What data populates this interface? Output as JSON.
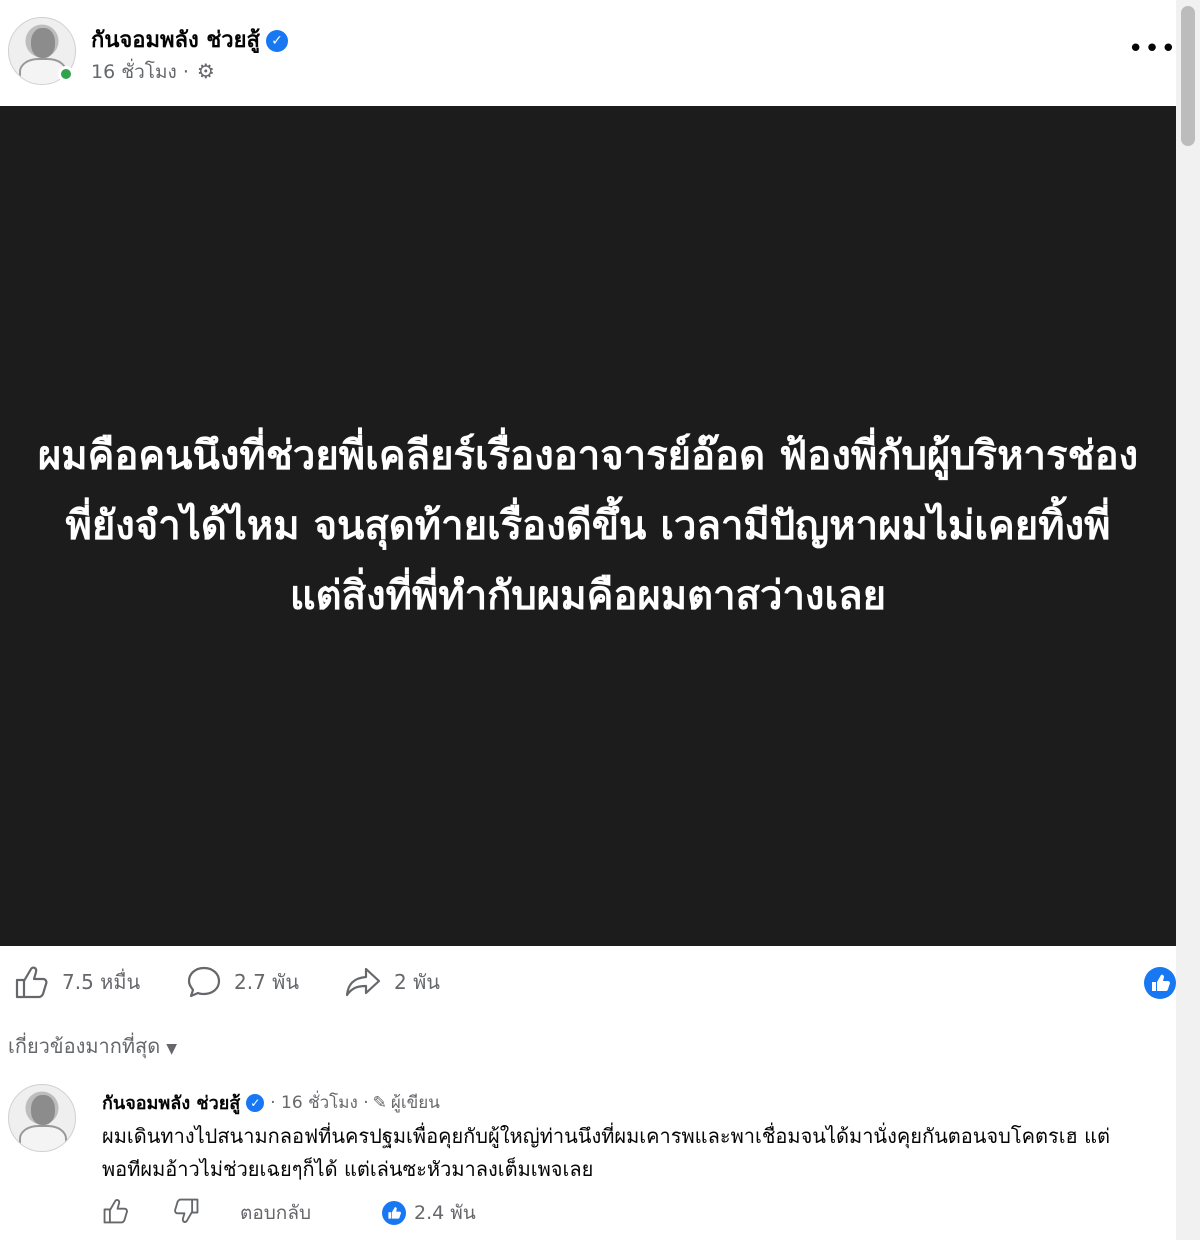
{
  "post": {
    "author": "กันจอมพลัง ช่วยสู้",
    "time": "16 ชั่วโมง ·",
    "image_text": "ผมคือคนนึงที่ช่วยพี่เคลียร์เรื่องอาจารย์อ๊อด ฟ้องพี่กับผู้บริหารช่อง พี่ยังจำได้ไหม จนสุดท้ายเรื่องดีขึ้น เวลามีปัญหาผมไม่เคยทิ้งพี่ แต่สิ่งที่พี่ทำกับผมคือผมตาสว่างเลย"
  },
  "stats": {
    "likes": "7.5 หมื่น",
    "comments": "2.7 พัน",
    "shares": "2 พัน"
  },
  "sort_label": "เกี่ยวข้องมากที่สุด",
  "comment": {
    "author": "กันจอมพลัง ช่วยสู้",
    "time": "· 16 ชั่วโมง ·",
    "badge": "ผู้เขียน",
    "text": "ผมเดินทางไปสนามกลอฟที่นครปฐมเพื่อคุยกับผู้ใหญ่ท่านนึงที่ผมเคารพและพาเชื่อมจนได้มานั่งคุยกันตอนจบโคตรเฮ แต่พอทีผมอ้าวไม่ช่วยเฉยๆก็ได้ แต่เล่นซะหัวมาลงเต็มเพจเลย",
    "reply_label": "ตอบกลับ",
    "reaction_count": "2.4 พัน"
  },
  "colors": {
    "accent": "#1877f2",
    "image_bg": "#1c1c1c",
    "muted_text": "#65676b",
    "online": "#31a24c"
  },
  "icons": [
    "verified-badge-icon",
    "gear-icon",
    "more-icon",
    "like-icon",
    "comment-icon",
    "share-icon",
    "dislike-icon",
    "pen-icon",
    "chevron-down-icon"
  ]
}
